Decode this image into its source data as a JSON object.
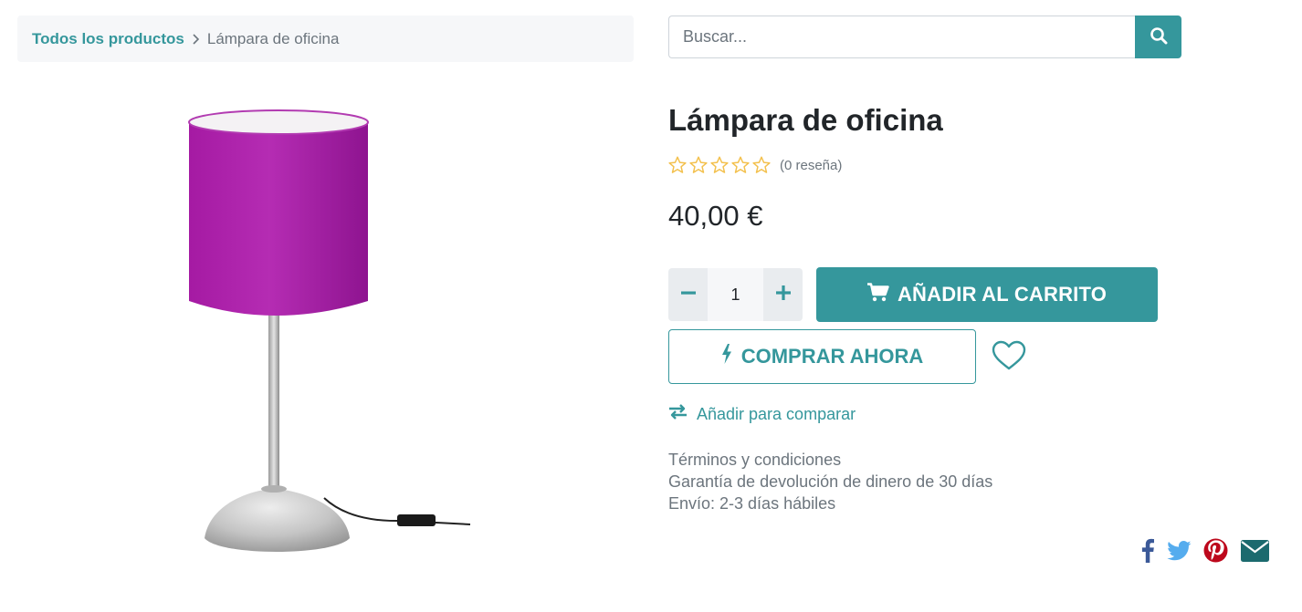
{
  "breadcrumb": {
    "parent_label": "Todos los productos",
    "current_label": "Lámpara de oficina",
    "separator_icon": "chevron-right-icon"
  },
  "search": {
    "placeholder": "Buscar...",
    "value": "",
    "button_icon": "search-icon"
  },
  "product": {
    "image_icon": "lamp-image",
    "title": "Lámpara de oficina",
    "rating": {
      "stars_filled": 0,
      "stars_total": 5,
      "reviews_label": "(0 reseña)"
    },
    "price": "40,00 €"
  },
  "quantity": {
    "value": "1",
    "decrease_icon": "minus-icon",
    "increase_icon": "plus-icon"
  },
  "actions": {
    "add_to_cart_label": "AÑADIR AL CARRITO",
    "add_to_cart_icon": "cart-icon",
    "buy_now_label": "COMPRAR AHORA",
    "buy_now_icon": "bolt-icon",
    "wishlist_icon": "heart-icon",
    "compare_label": "Añadir para comparar",
    "compare_icon": "exchange-icon"
  },
  "info": {
    "lines": [
      "Términos y condiciones",
      "Garantía de devolución de dinero de 30 días",
      "Envío: 2-3 días hábiles"
    ]
  },
  "share": {
    "icons": [
      "facebook-icon",
      "twitter-icon",
      "pinterest-icon",
      "email-icon"
    ]
  },
  "colors": {
    "accent": "#35979c",
    "star": "#f3c04c",
    "text": "#212529",
    "muted": "#6c757d",
    "facebook": "#3b5998",
    "twitter": "#55acee",
    "pinterest": "#bd081c",
    "email": "#1c6a6e"
  }
}
